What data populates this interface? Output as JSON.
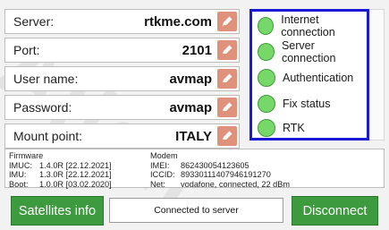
{
  "watermark": "Allan",
  "fields": {
    "server": {
      "label": "Server:",
      "value": "rtkme.com"
    },
    "port": {
      "label": "Port:",
      "value": "2101"
    },
    "username": {
      "label": "User name:",
      "value": "avmap"
    },
    "password": {
      "label": "Password:",
      "value": "avmap"
    },
    "mountpoint": {
      "label": "Mount point:",
      "value": "ITALY"
    }
  },
  "edit_icon": "pencil-icon",
  "status": {
    "internet": "Internet connection",
    "server": "Server connection",
    "auth": "Authentication",
    "fix": "Fix status",
    "rtk": "RTK",
    "led_color": "#77d86a"
  },
  "firmware": {
    "title": "Firmware",
    "rows": [
      {
        "key": "IMUC:",
        "value": "1.4.0R [22.12.2021]"
      },
      {
        "key": "IMU:",
        "value": "1.3.0R [22.12.2021]"
      },
      {
        "key": "Boot:",
        "value": "1.0.0R [03.02.2020]"
      }
    ]
  },
  "modem": {
    "title": "Modem",
    "rows": [
      {
        "key": "IMEI:",
        "value": "862430054123605"
      },
      {
        "key": "ICCID:",
        "value": "8933011140794619127​0"
      },
      {
        "key": "Net:",
        "value": "vodafone, connected, 22 dBm"
      }
    ]
  },
  "footer": {
    "satellites_label": "Satellites info",
    "status_message": "Connected to server",
    "disconnect_label": "Disconnect"
  },
  "colors": {
    "accent_green": "#3e9a3e",
    "edit_button": "#e09179",
    "panel_border": "#1a1ad6"
  }
}
